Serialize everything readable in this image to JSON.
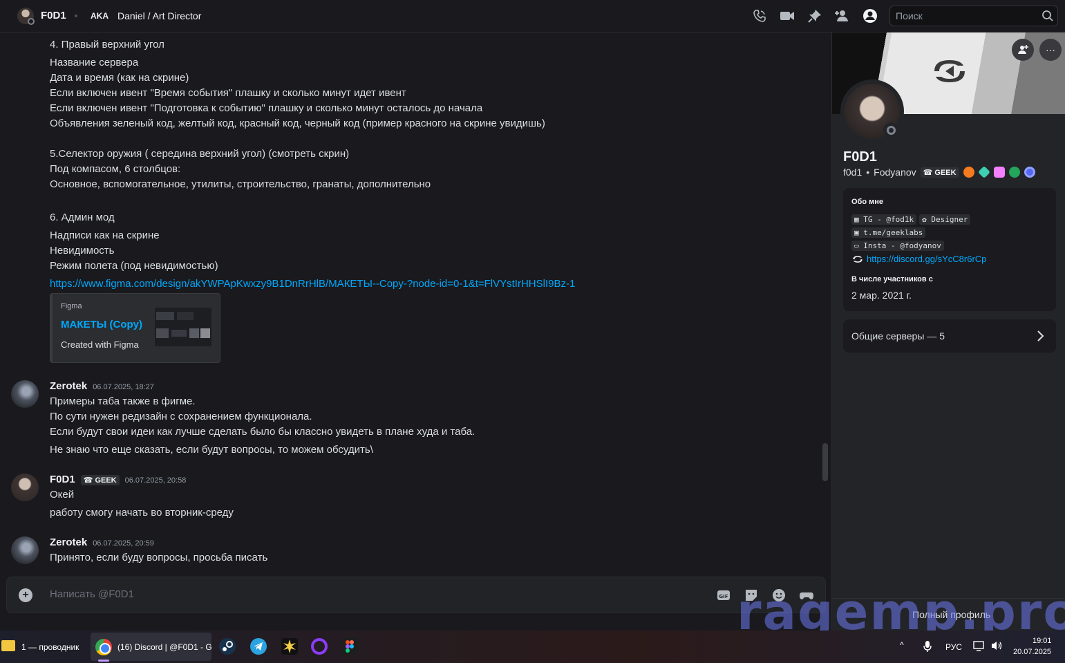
{
  "topbar": {
    "name": "F0D1",
    "aka_label": "AKA",
    "nickname": "Daniel / Art Director",
    "search_placeholder": "Поиск",
    "icons": [
      "voice-call-icon",
      "video-call-icon",
      "pin-icon",
      "add-friends-icon",
      "user-profile-icon",
      "search-icon"
    ]
  },
  "chat": {
    "first_message_lines": [
      "4. Правый верхний угол",
      "Название сервера",
      "Дата и время (как на скрине)",
      "Если включен ивент \"Время события\" плашку и сколько минут идет ивент",
      "Если включен ивент \"Подготовка к событию\" плашку и сколько минут осталось до начала",
      "Объявления зеленый код, желтый код, красный код, черный код (пример красного на скрине увидишь)",
      "5.Селектор оружия ( середина верхний угол)  (смотреть скрин)",
      "Под компасом, 6 столбцов:",
      "Основное, вспомогательное, утилиты, строительство, гранаты, дополнительно",
      "6. Админ  мод",
      "Надписи как на скрине",
      "Невидимость",
      "Режим полета (под невидимостью)"
    ],
    "link": "https://www.figma.com/design/akYWPApKwxzy9B1DnRrHlB/МАКЕТЫ--Copy-?node-id=0-1&t=FlVYstIrHHSlI9Bz-1",
    "embed": {
      "provider": "Figma",
      "title": "МАКЕТЫ (Copy)",
      "description": "Created with Figma"
    },
    "messages": [
      {
        "author": "Zerotek",
        "timestamp": "06.07.2025, 18:27",
        "lines": [
          "Примеры таба также в фигме.",
          "По сути нужен редизайн с сохранением функционала.",
          "Если будут свои идеи как лучше сделать было бы классно увидеть в плане худа и таба.",
          "Не знаю что еще сказать, если будут вопросы, то можем обсудить\\"
        ]
      },
      {
        "author": "F0D1",
        "tag": "GEEK",
        "timestamp": "06.07.2025, 20:58",
        "lines": [
          "Окей",
          "работу смогу начать во вторник-среду"
        ]
      },
      {
        "author": "Zerotek",
        "timestamp": "06.07.2025, 20:59",
        "lines": [
          "Принято, если буду вопросы, просьба писать"
        ]
      }
    ],
    "composer_placeholder": "Написать @F0D1",
    "composer_icons": [
      "gif-icon",
      "sticker-icon",
      "emoji-icon",
      "activity-icon"
    ]
  },
  "profile": {
    "display_name": "F0D1",
    "username": "f0d1",
    "separator": "•",
    "pronouns": "Fodyanov",
    "tag": "GEEK",
    "about_title": "Обо мне",
    "about": {
      "tg": "TG - @fod1k",
      "role": "Designer",
      "channel": "t.me/geeklabs",
      "insta": "Insta - @fodyanov",
      "discord_link": "https://discord.gg/sYcC8r6rCp"
    },
    "member_since_title": "В числе участников с",
    "member_since": "2 мар. 2021 г.",
    "mutual_servers": "Общие серверы — 5",
    "full_profile": "Полный профиль"
  },
  "watermark": "ragemp.pro",
  "taskbar": {
    "explorer_label": "1 — проводник",
    "chrome_label": "(16) Discord | @F0D1 - G",
    "language": "РУС",
    "time": "19:01",
    "date": "20.07.2025"
  },
  "colors": {
    "background": "#1a1a1e",
    "panel": "#232428",
    "link": "#00a8fc",
    "text": "#dbdee1"
  }
}
